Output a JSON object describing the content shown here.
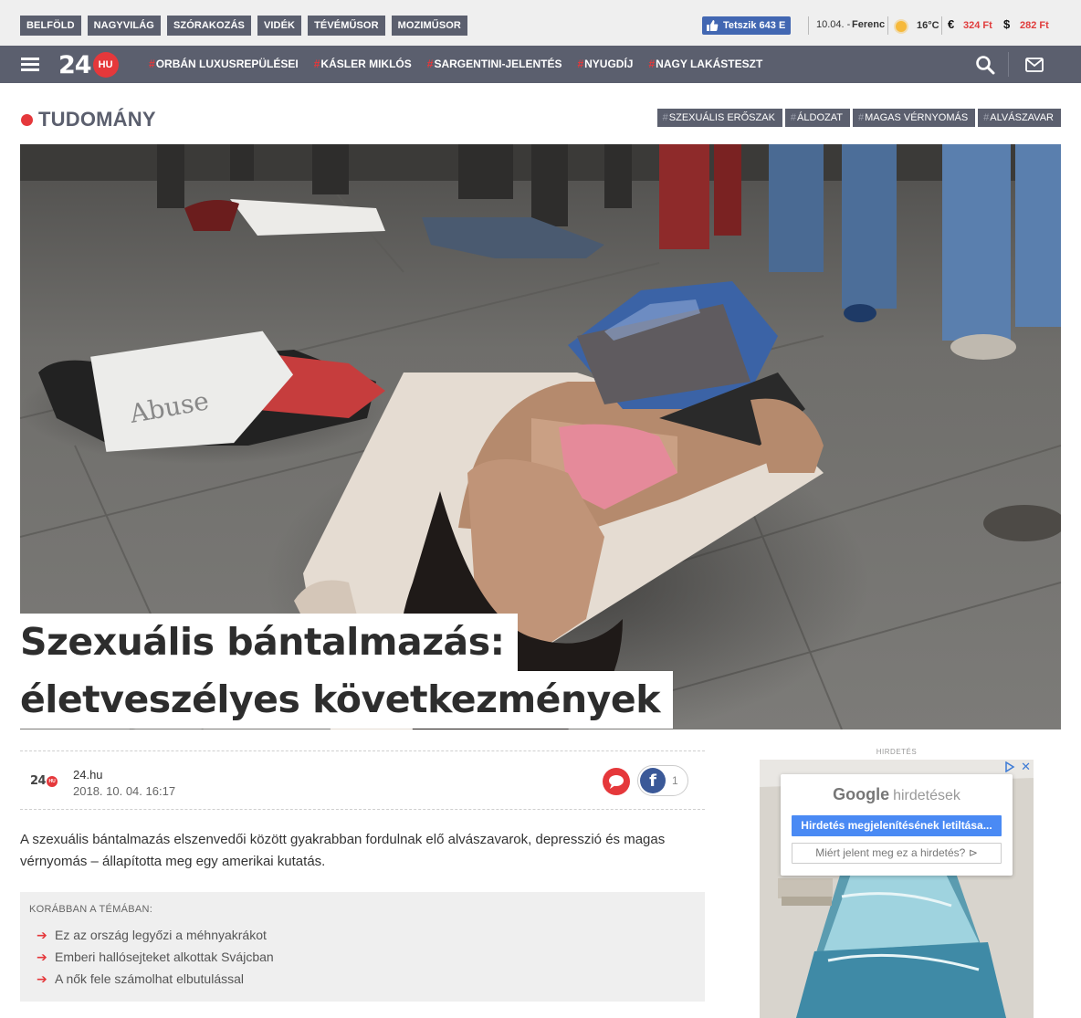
{
  "topnav": [
    "BELFÖLD",
    "NAGYVILÁG",
    "SZÓRAKOZÁS",
    "VIDÉK",
    "TÉVÉMŰSOR",
    "MOZIMŰSOR"
  ],
  "facebook_like": "Tetszik 643 E",
  "date": "10.04. -",
  "nameday": "Ferenc",
  "temperature": "16°C",
  "currency": {
    "eur_symbol": "€",
    "eur_value": "324 Ft",
    "usd_symbol": "$",
    "usd_value": "282 Ft"
  },
  "logo": {
    "number": "24",
    "suffix": "HU"
  },
  "trends": [
    "ORBÁN LUXUSREPÜLÉSEI",
    "KÁSLER MIKLÓS",
    "SARGENTINI-JELENTÉS",
    "NYUGDÍJ",
    "NAGY LAKÁSTESZT"
  ],
  "section": "TUDOMÁNY",
  "tags": [
    "SZEXUÁLIS ERŐSZAK",
    "ÁLDOZAT",
    "MAGAS VÉRNYOMÁS",
    "ALVÁSZAVAR"
  ],
  "headline": {
    "line1": "Szexuális bántalmazás:",
    "line2": "életveszélyes következmények"
  },
  "article": {
    "author": "24.hu",
    "date": "2018. 10. 04. 16:17",
    "fb_count": "1",
    "lead": "A szexuális bántalmazás elszenvedői között gyakrabban fordulnak elő alvászavarok, depresszió és magas vérnyomás – állapította meg egy amerikai kutatás."
  },
  "related": {
    "heading": "KORÁBBAN A TÉMÁBAN:",
    "items": [
      "Ez az ország legyőzi a méhnyakrákot",
      "Emberi hallósejteket alkottak Svájcban",
      "A nők fele számolhat elbutulással"
    ]
  },
  "ad": {
    "label": "HIRDETÉS",
    "google": "Google",
    "google_suffix": "hirdetések",
    "stop_button": "Hirdetés megjelenítésének letiltása...",
    "why_button": "Miért jelent meg ez a hirdetés?",
    "close": "✕"
  },
  "colors": {
    "accent": "#e5383b",
    "nav": "#5b5f6e",
    "facebook": "#3b5998",
    "google_blue": "#4a8af4"
  }
}
